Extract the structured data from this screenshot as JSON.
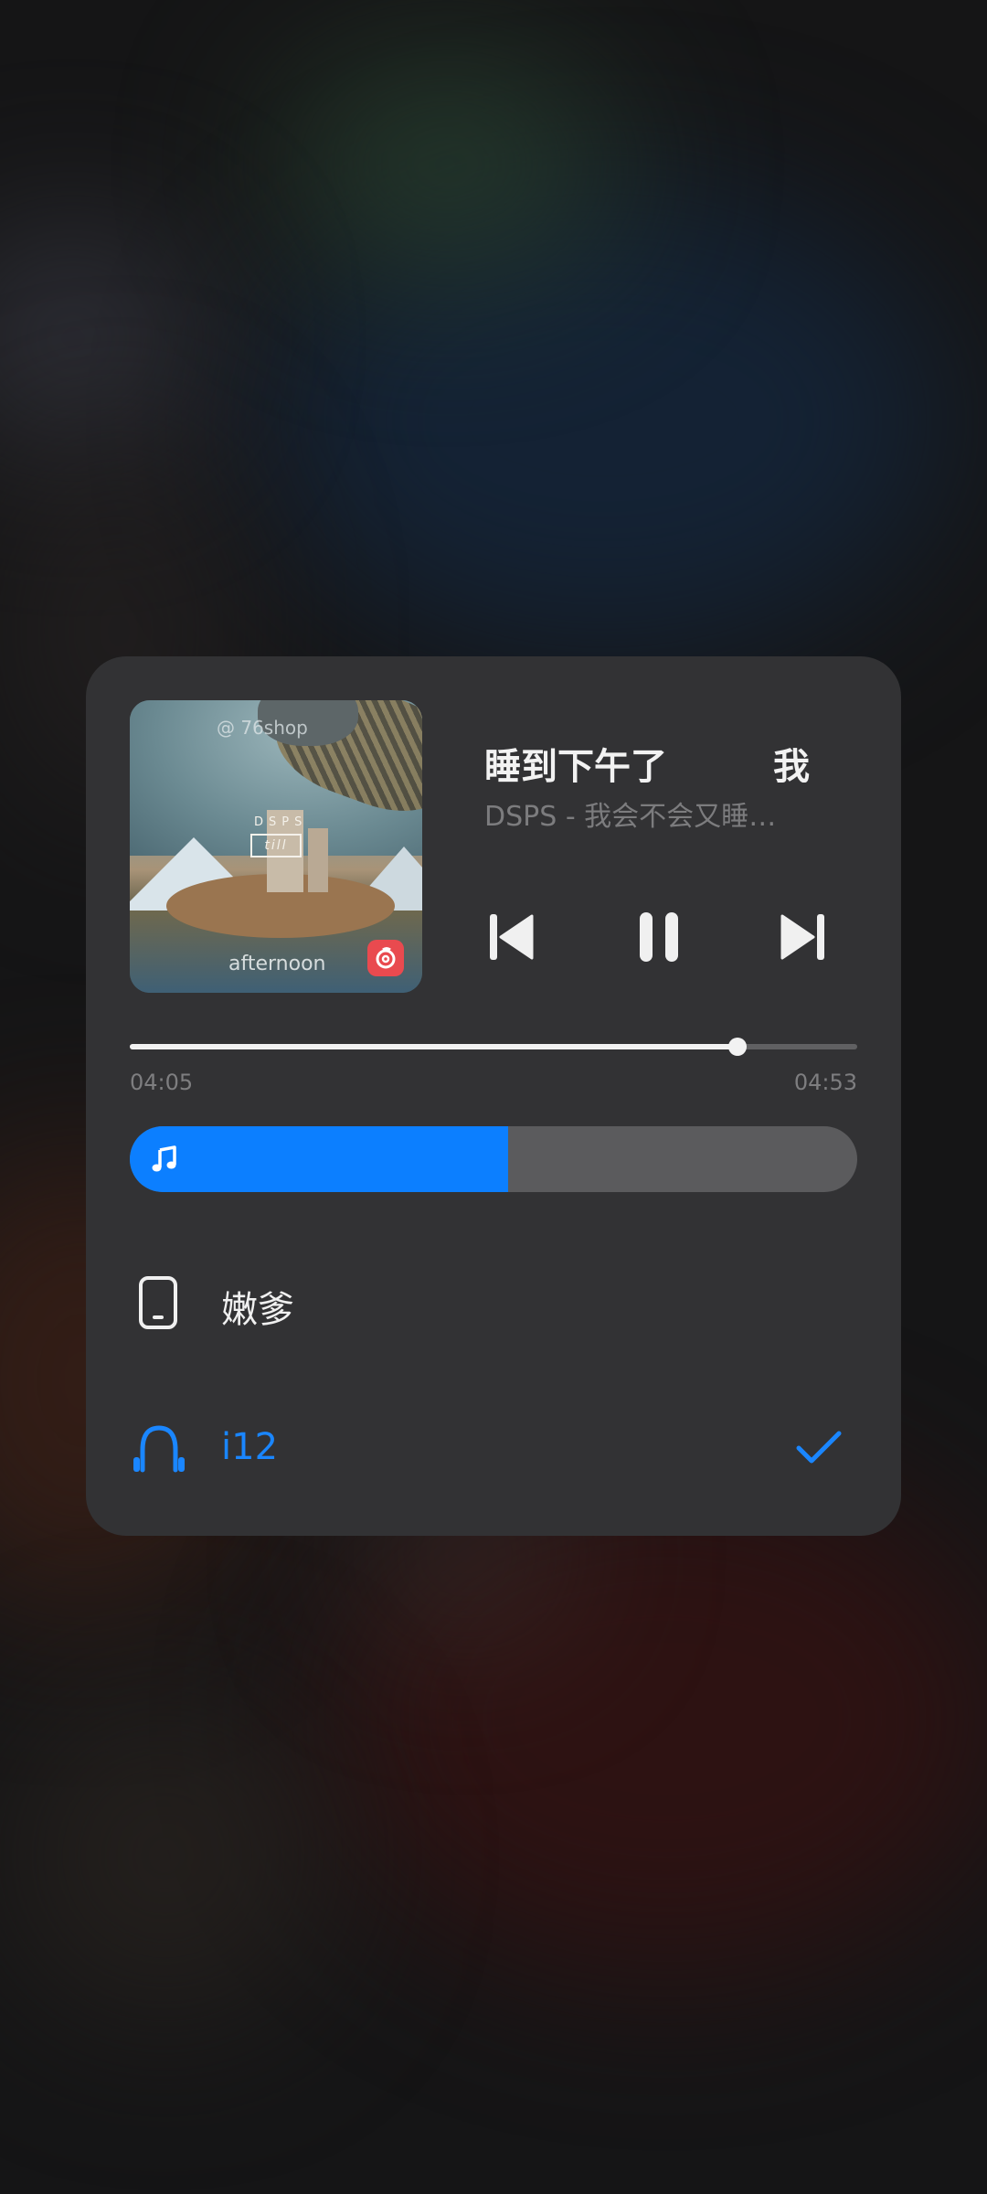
{
  "player": {
    "title_parts": [
      "睡到下午了",
      "我"
    ],
    "subtitle": "DSPS - 我会不会又睡到下午了",
    "album_art": {
      "top_text": "@ 76shop",
      "brand": "DSPS",
      "label": "till",
      "bottom_text": "afternoon",
      "badge_icon": "netease-music-icon"
    },
    "controls": {
      "previous_icon": "skip-previous-icon",
      "play_pause_icon": "pause-icon",
      "next_icon": "skip-next-icon"
    },
    "progress": {
      "current": "04:05",
      "total": "04:53",
      "fraction": 0.835
    },
    "volume": {
      "icon": "music-note-icon",
      "fraction": 0.52,
      "fill_color": "#0C7FFF"
    }
  },
  "devices": [
    {
      "name": "嫩爹",
      "icon": "phone-icon",
      "selected": false
    },
    {
      "name": "i12",
      "icon": "earbuds-icon",
      "selected": true,
      "selected_icon": "checkmark-icon",
      "accent": "#1A86FF"
    }
  ]
}
